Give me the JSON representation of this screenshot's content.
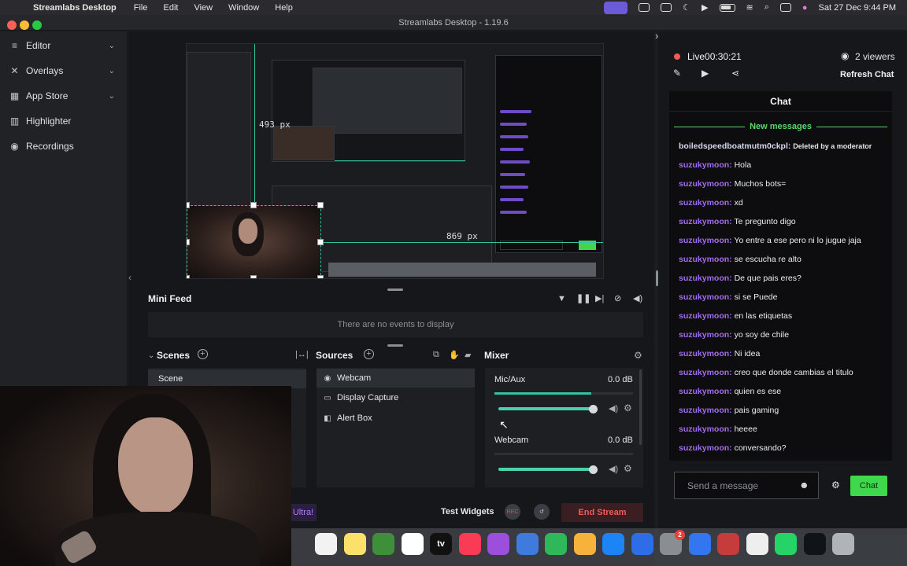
{
  "menubar": {
    "app_name": "Streamlabs Desktop",
    "items": [
      "File",
      "Edit",
      "View",
      "Window",
      "Help"
    ],
    "datetime": "Sat 27 Dec  9:44 PM"
  },
  "window": {
    "title": "Streamlabs Desktop - 1.19.6"
  },
  "nav": {
    "items": [
      {
        "label": "Editor",
        "icon": "editor-icon"
      },
      {
        "label": "Overlays",
        "icon": "overlays-icon"
      },
      {
        "label": "App Store",
        "icon": "app-store-icon"
      },
      {
        "label": "Highlighter",
        "icon": "highlighter-icon"
      },
      {
        "label": "Recordings",
        "icon": "recordings-icon"
      }
    ]
  },
  "preview": {
    "width_label": "493 px",
    "height_label": "869 px"
  },
  "minifeed": {
    "title": "Mini Feed",
    "empty": "There are no events to display"
  },
  "scenes": {
    "title": "Scenes",
    "items": [
      "Scene"
    ]
  },
  "sources": {
    "title": "Sources",
    "items": [
      "Webcam",
      "Display Capture",
      "Alert Box"
    ]
  },
  "mixer": {
    "title": "Mixer",
    "channels": [
      {
        "name": "Mic/Aux",
        "db": "0.0 dB",
        "level": 0.7,
        "volume": 1.0
      },
      {
        "name": "Webcam",
        "db": "0.0 dB",
        "level": 0.0,
        "volume": 1.0
      }
    ]
  },
  "footer": {
    "ultra": "Ultra!",
    "test_widgets": "Test Widgets",
    "rec": "REC",
    "end_stream": "End Stream"
  },
  "chat": {
    "live_label": "Live",
    "live_time": "00:30:21",
    "viewers": "2 viewers",
    "refresh": "Refresh Chat",
    "title": "Chat",
    "new_messages": "New messages",
    "messages": [
      {
        "user": "boiledspeedboatmutm0ckpl:",
        "text": "Deleted by a moderator",
        "deleted": true
      },
      {
        "user": "suzukymoon:",
        "text": "Hola"
      },
      {
        "user": "suzukymoon:",
        "text": "Muchos bots="
      },
      {
        "user": "suzukymoon:",
        "text": "xd"
      },
      {
        "user": "suzukymoon:",
        "text": "Te pregunto digo"
      },
      {
        "user": "suzukymoon:",
        "text": "Yo entre a ese pero ni lo jugue jaja"
      },
      {
        "user": "suzukymoon:",
        "text": "se escucha re alto"
      },
      {
        "user": "suzukymoon:",
        "text": "De que pais eres?"
      },
      {
        "user": "suzukymoon:",
        "text": "si se Puede"
      },
      {
        "user": "suzukymoon:",
        "text": "en las etiquetas"
      },
      {
        "user": "suzukymoon:",
        "text": "yo soy de chile"
      },
      {
        "user": "suzukymoon:",
        "text": "Ni idea"
      },
      {
        "user": "suzukymoon:",
        "text": "creo que donde cambias el titulo"
      },
      {
        "user": "suzukymoon:",
        "text": "quien es ese"
      },
      {
        "user": "suzukymoon:",
        "text": "pais gaming"
      },
      {
        "user": "suzukymoon:",
        "text": "heeee"
      },
      {
        "user": "suzukymoon:",
        "text": "conversando?"
      }
    ],
    "input_placeholder": "Send a message",
    "send": "Chat"
  },
  "dock": {
    "badge": "2",
    "apps": [
      "reminders-icon",
      "notes-icon",
      "minecraft-icon",
      "freeform-icon",
      "apple-tv-icon",
      "music-icon",
      "podcasts-icon",
      "keynote-icon",
      "numbers-icon",
      "pages-icon",
      "app-store-icon",
      "roblox-icon",
      "system-settings-icon",
      "docs-icon",
      "photo-booth-icon",
      "chrome-icon",
      "whatsapp-icon",
      "streamlabs-icon",
      "trash-icon"
    ],
    "tv_label": "tv"
  },
  "colors": {
    "accent": "#31c3a2",
    "live": "#f25a5a",
    "chat_user": "#a36cf0",
    "send": "#3fd84d"
  }
}
